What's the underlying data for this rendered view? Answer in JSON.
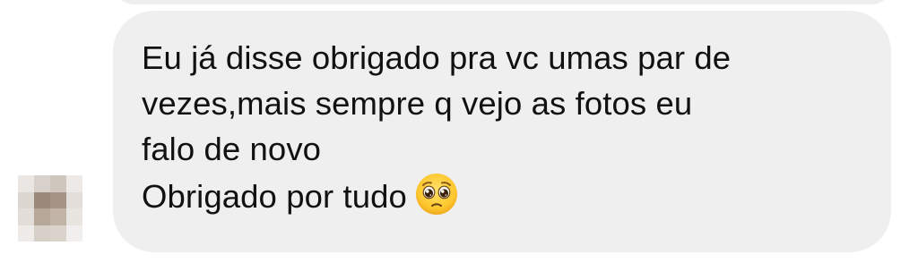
{
  "message": {
    "lines": [
      "Eu já disse obrigado pra vc umas par de",
      "vezes,mais sempre q vejo as fotos eu",
      "falo de novo",
      "Obrigado por tudo"
    ],
    "emoji": "pleading-face-emoji",
    "bubble_color": "#efefef",
    "text_color": "#111111"
  },
  "sender_avatar": {
    "style": "pixelated",
    "tiles": [
      "#e9e6e3",
      "#d8d1cb",
      "#cfc6bd",
      "#ece9e6",
      "#dcd6d0",
      "#9b8a7c",
      "#a69586",
      "#e3ded9",
      "#e2ddd8",
      "#b6a799",
      "#c2b4a7",
      "#e8e4e0",
      "#eeebe8",
      "#d7d0c9",
      "#dad3cc",
      "#f1efed"
    ]
  }
}
